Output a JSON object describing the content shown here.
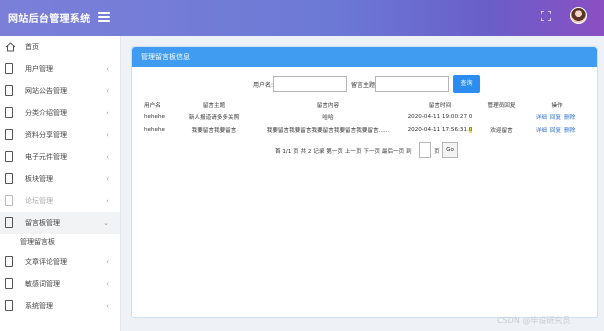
{
  "header": {
    "brand": "网站后台管理系统"
  },
  "sidebar": {
    "items": [
      {
        "label": "首页",
        "arrow": ""
      },
      {
        "label": "用户管理",
        "arrow": "‹"
      },
      {
        "label": "网站公告管理",
        "arrow": "‹"
      },
      {
        "label": "分类介绍管理",
        "arrow": "‹"
      },
      {
        "label": "资料分享管理",
        "arrow": "‹"
      },
      {
        "label": "电子元件管理",
        "arrow": "‹"
      },
      {
        "label": "板块管理",
        "arrow": "‹"
      },
      {
        "label": "论坛管理",
        "arrow": "‹"
      },
      {
        "label": "留言板管理",
        "arrow": "⌄"
      },
      {
        "label": "文章评论管理",
        "arrow": "‹"
      },
      {
        "label": "敏感词管理",
        "arrow": "‹"
      },
      {
        "label": "系统管理",
        "arrow": "‹"
      }
    ],
    "sub_item": "管理留言板"
  },
  "panel": {
    "title": "管理留言板信息",
    "search": {
      "username_label": "用户名:",
      "username_value": "",
      "subject_label": "留言主题:",
      "subject_value": "",
      "button": "查询"
    },
    "table": {
      "columns": [
        "用户名",
        "留言主题",
        "留言内容",
        "留言时间",
        "管理员回复",
        "操作"
      ],
      "rows": [
        {
          "user": "hehehe",
          "subject": "新人报道请多多关照",
          "content": "哈哈",
          "time_a": "2020-04-11 19:00:27 ",
          "time_b": "0",
          "reply": "",
          "ops": [
            "详细",
            "回复",
            "删除"
          ]
        },
        {
          "user": "hehehe",
          "subject": "我要留言我要留言",
          "content": "我要留言我要留言我要留言我要留言我要留言......",
          "time_a": "2020-04-11 17:56:31.",
          "time_b": "0",
          "reply": "欢迎留言",
          "ops": [
            "详细",
            "回复",
            "删除"
          ]
        }
      ]
    },
    "pager": {
      "text": "首 1/1 页 共 2 记录 第一页 上一页 下一页 最后一页 到",
      "page_value": "",
      "page_suffix": "页",
      "go": "Go"
    }
  },
  "watermark": "CSDN @毕设研究员",
  "colors": {
    "header_from": "#7b7fd8",
    "header_to": "#8a4fc2",
    "panel_head": "#3f9cf0",
    "button": "#2d8cf0",
    "link": "#2d6fd0"
  }
}
